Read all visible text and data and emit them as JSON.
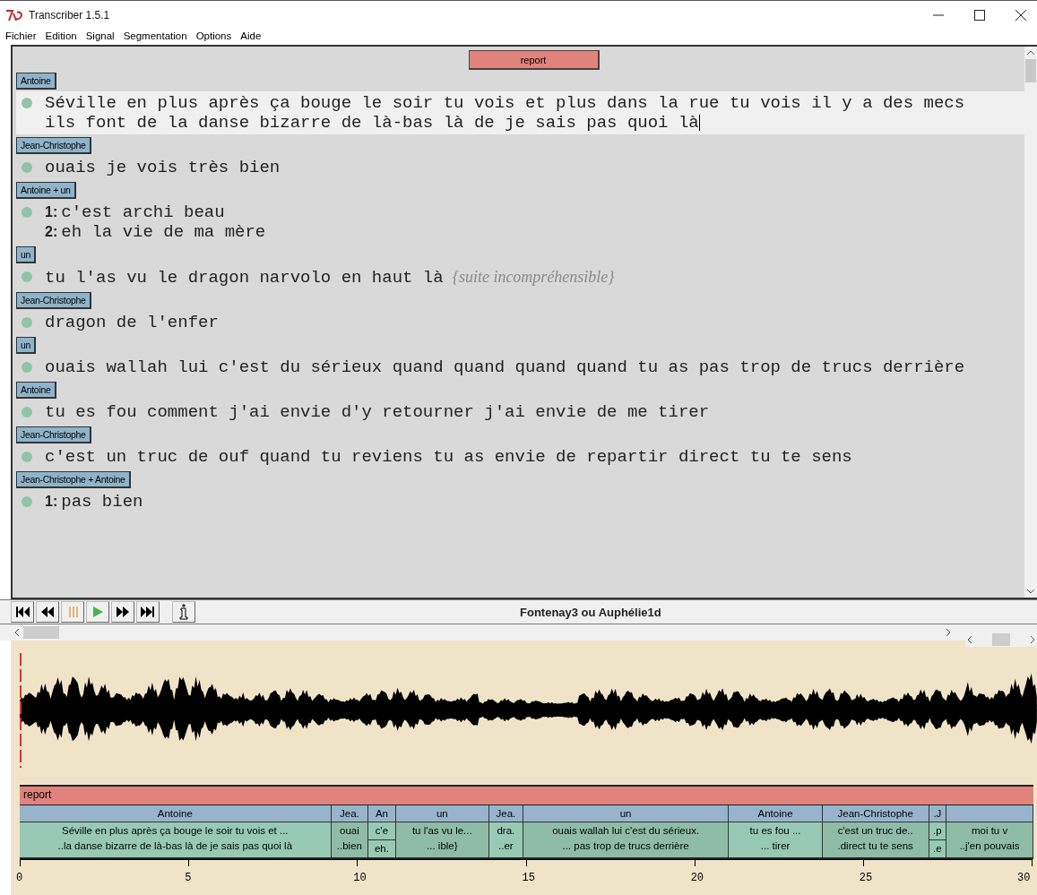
{
  "window": {
    "title": "Transcriber 1.5.1"
  },
  "menu": [
    "Fichier",
    "Edition",
    "Signal",
    "Segmentation",
    "Options",
    "Aide"
  ],
  "section": {
    "label": "report"
  },
  "turns": [
    {
      "speaker": "Antoine",
      "selected": true,
      "lines": [
        {
          "text": "Séville en plus après ça bouge le soir tu vois et plus dans la rue tu vois il y a des mecs"
        },
        {
          "text": "ils font de la danse bizarre de là-bas là de je sais pas quoi là"
        }
      ]
    },
    {
      "speaker": "Jean-Christophe",
      "selected": false,
      "lines": [
        {
          "text": "ouais je vois très bien"
        }
      ]
    },
    {
      "speaker": "Antoine + un",
      "selected": false,
      "lines": [
        {
          "number": "1:",
          "text": "c'est archi beau"
        },
        {
          "number": "2:",
          "text": "eh la vie de ma mère"
        }
      ]
    },
    {
      "speaker": "un",
      "selected": false,
      "lines": [
        {
          "text": "tu l'as vu le dragon narvolo en haut là",
          "comment": "{suite incompréhensible}"
        }
      ]
    },
    {
      "speaker": "Jean-Christophe",
      "selected": false,
      "lines": [
        {
          "text": "dragon de l'enfer"
        }
      ]
    },
    {
      "speaker": "un",
      "selected": false,
      "lines": [
        {
          "text": "ouais wallah lui c'est du sérieux quand quand quand quand tu as pas trop de trucs derrière"
        }
      ]
    },
    {
      "speaker": "Antoine",
      "selected": false,
      "lines": [
        {
          "text": "tu es fou comment j'ai envie d'y retourner j'ai envie de me tirer"
        }
      ]
    },
    {
      "speaker": "Jean-Christophe",
      "selected": false,
      "lines": [
        {
          "text": "c'est un truc de ouf quand tu reviens tu as envie de repartir direct tu te sens"
        }
      ]
    },
    {
      "speaker": "Jean-Christophe + Antoine",
      "selected": false,
      "lines": [
        {
          "number": "1:",
          "text": "pas bien"
        }
      ]
    }
  ],
  "player": {
    "title": "Fontenay3 ou Auphélie1d"
  },
  "segmentation": {
    "section": "report",
    "segments": [
      {
        "speaker": "Antoine",
        "kind": "single",
        "text": [
          "Séville en plus après ça bouge le soir tu vois et ...",
          "..la danse bizarre de là-bas là de je sais pas quoi là"
        ]
      },
      {
        "speaker": "Jea.",
        "kind": "single",
        "text": [
          "ouai",
          "..bien"
        ]
      },
      {
        "speaker": "An",
        "kind": "split",
        "text": [
          "c'e",
          "eh."
        ]
      },
      {
        "speaker": "un",
        "kind": "single",
        "text": [
          "tu l'as vu le...",
          "... ible}"
        ]
      },
      {
        "speaker": "Jea.",
        "kind": "single",
        "text": [
          "dra.",
          "..er"
        ]
      },
      {
        "speaker": "un",
        "kind": "single",
        "text": [
          "ouais wallah lui c'est du sérieux.",
          "... pas trop de trucs derrière"
        ]
      },
      {
        "speaker": "Antoine",
        "kind": "single",
        "text": [
          "tu es fou ...",
          "... tirer"
        ]
      },
      {
        "speaker": "Jean-Christophe",
        "kind": "single",
        "text": [
          "c'est un truc de..",
          ".direct tu te sens"
        ]
      },
      {
        "speaker": ".J",
        "kind": "split",
        "text": [
          ".p",
          ".e"
        ]
      },
      {
        "kind": "single",
        "text": [
          "moi tu v",
          "..j'en pouvais"
        ]
      }
    ],
    "axis_ticks": [
      "0",
      "5",
      "10",
      "15",
      "20",
      "25",
      "30"
    ]
  }
}
